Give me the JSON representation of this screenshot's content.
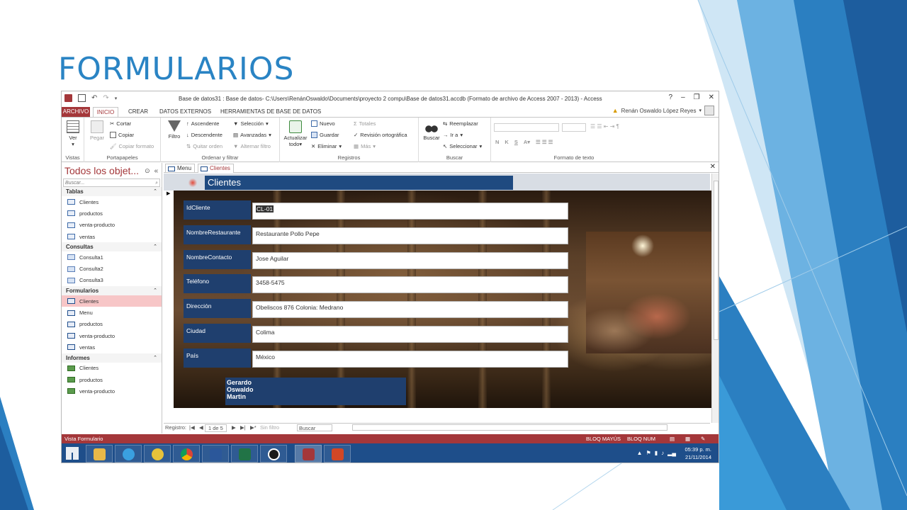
{
  "slide": {
    "title": "FORMULARIOS"
  },
  "window": {
    "title": "Base de datos31 : Base de datos- C:\\Users\\RenánOswaldo\\Documents\\proyecto 2 compu\\Base de datos31.accdb (Formato de archivo de Access 2007 - 2013) - Access",
    "controls": {
      "help": "?",
      "minimize": "–",
      "restore": "❐",
      "close": "✕"
    },
    "user": "Renán Oswaldo López Reyes"
  },
  "ribbon_tabs": [
    "ARCHIVO",
    "INICIO",
    "CREAR",
    "DATOS EXTERNOS",
    "HERRAMIENTAS DE BASE DE DATOS"
  ],
  "ribbon": {
    "vistas": {
      "label": "Vistas",
      "ver": "Ver"
    },
    "portapapeles": {
      "label": "Portapapeles",
      "pegar": "Pegar",
      "cortar": "Cortar",
      "copiar": "Copiar",
      "copiar_formato": "Copiar formato"
    },
    "ordenar": {
      "label": "Ordenar y filtrar",
      "filtro": "Filtro",
      "ascendente": "Ascendente",
      "descendente": "Descendente",
      "quitar_orden": "Quitar orden",
      "seleccion": "Selección",
      "avanzadas": "Avanzadas",
      "alternar_filtro": "Alternar filtro"
    },
    "registros": {
      "label": "Registros",
      "actualizar": "Actualizar",
      "todo": "todo",
      "nuevo": "Nuevo",
      "guardar": "Guardar",
      "eliminar": "Eliminar",
      "totales": "Totales",
      "revision": "Revisión ortográfica",
      "mas": "Más"
    },
    "buscar": {
      "label": "Buscar",
      "buscar": "Buscar",
      "reemplazar": "Reemplazar",
      "ir_a": "Ir a",
      "seleccionar": "Seleccionar"
    },
    "formato": {
      "label": "Formato de texto",
      "n": "N",
      "k": "K",
      "s": "S"
    }
  },
  "nav": {
    "header": "Todos los objet...",
    "search_placeholder": "Buscar...",
    "sections": [
      {
        "title": "Tablas",
        "items": [
          "Clientes",
          "productos",
          "venta-producto",
          "ventas"
        ]
      },
      {
        "title": "Consultas",
        "items": [
          "Consulta1",
          "Consulta2",
          "Consulta3"
        ]
      },
      {
        "title": "Formularios",
        "items": [
          "Clientes",
          "Menu",
          "productos",
          "venta-producto",
          "ventas"
        ]
      },
      {
        "title": "Informes",
        "items": [
          "Clientes",
          "productos",
          "venta-producto"
        ]
      }
    ]
  },
  "doc": {
    "tabs": [
      "Menu",
      "Clientes"
    ],
    "form_title": "Clientes",
    "fields": [
      {
        "label": "IdCliente",
        "value": "CL-01"
      },
      {
        "label": "NombreRestaurante",
        "value": "Restaurante Pollo Pepe"
      },
      {
        "label": "NombreContacto",
        "value": "Jose Aguilar"
      },
      {
        "label": "Teléfono",
        "value": "3458-5475"
      },
      {
        "label": "Dirección",
        "value": "Obeliscos 876 Colonia: Medrano"
      },
      {
        "label": "Ciudad",
        "value": "Colima"
      },
      {
        "label": "País",
        "value": "México"
      }
    ],
    "authors": [
      "Gerardo",
      "Oswaldo",
      "Martin"
    ],
    "record_nav": {
      "label": "Registro:",
      "position": "1 de 5",
      "filter": "Sin filtro",
      "search": "Buscar"
    }
  },
  "status": {
    "left": "Vista Formulario",
    "caps": "BLOQ MAYÚS",
    "num": "BLOQ NUM"
  },
  "taskbar": {
    "time": "05:39 p. m.",
    "date": "21/11/2014"
  },
  "colors": {
    "access_red": "#a4373a",
    "form_blue": "#1f3f6e",
    "slide_blue": "#2a84c4",
    "taskbar": "#1e4e8a"
  }
}
